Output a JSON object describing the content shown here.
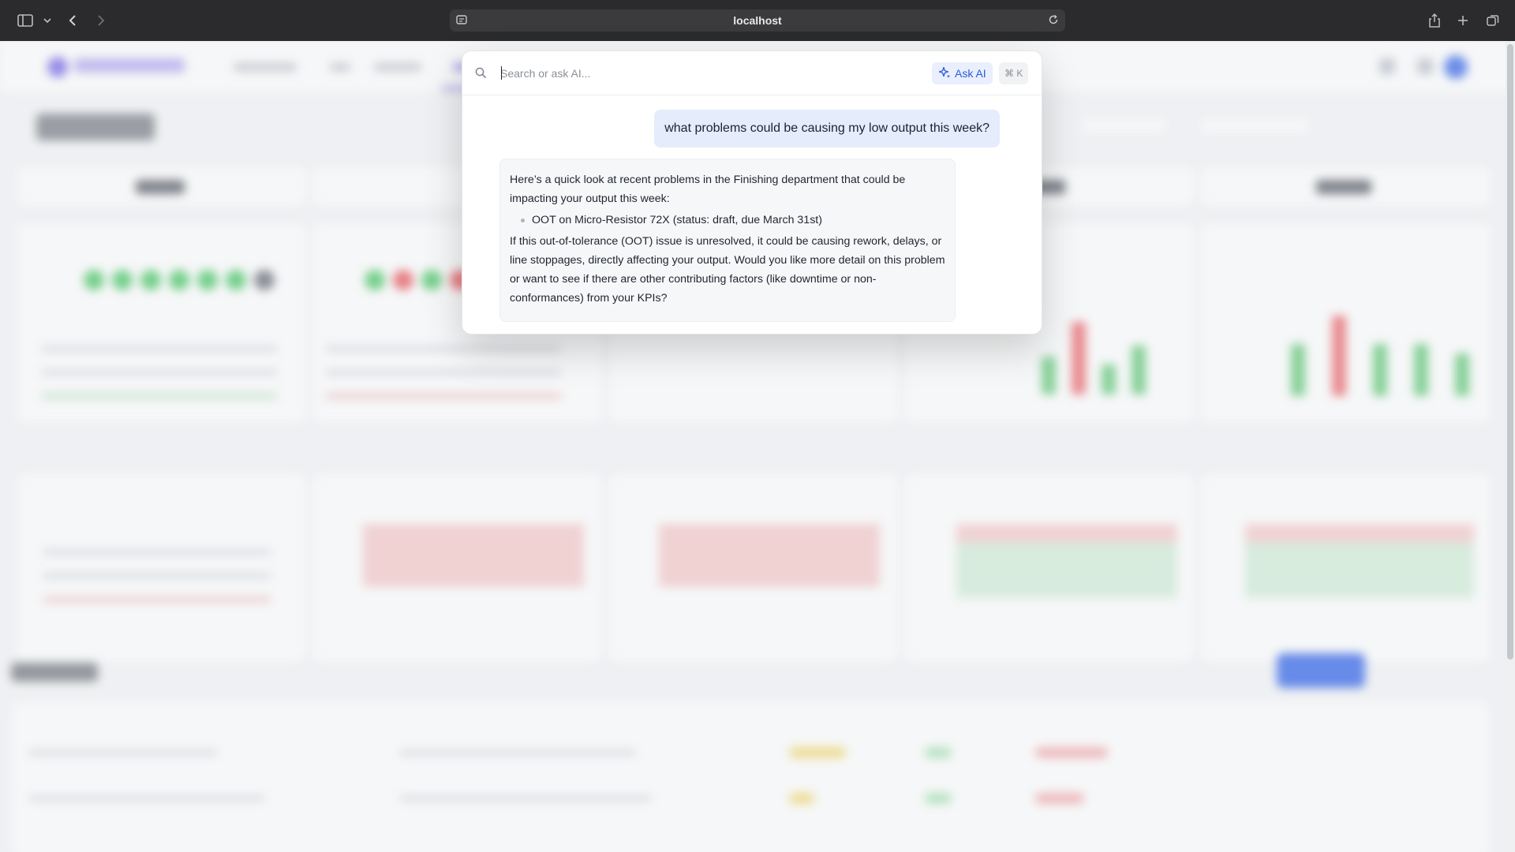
{
  "browser": {
    "url": "localhost"
  },
  "command_palette": {
    "search_placeholder": "Search or ask AI...",
    "ask_ai_label": "Ask AI",
    "shortcut_label": "⌘ K",
    "user_message": "what problems could be causing my low output this week?",
    "ai_response": {
      "intro": "Here’s a quick look at recent problems in the Finishing department that could be impacting your output this week:",
      "items": [
        "OOT on Micro-Resistor 72X (status: draft, due March 31st)"
      ],
      "outro": "If this out-of-tolerance (OOT) issue is unresolved, it could be causing rework, delays, or line stoppages, directly affecting your output. Would you like more detail on this problem or want to see if there are other contributing factors (like downtime or non-conformances) from your KPIs?"
    }
  },
  "colors": {
    "accent": "#2a5bd7",
    "user_bubble": "#e5ecfb",
    "ai_bubble": "#f6f7f8",
    "good": "#3cc35a",
    "bad": "#e8484f"
  }
}
